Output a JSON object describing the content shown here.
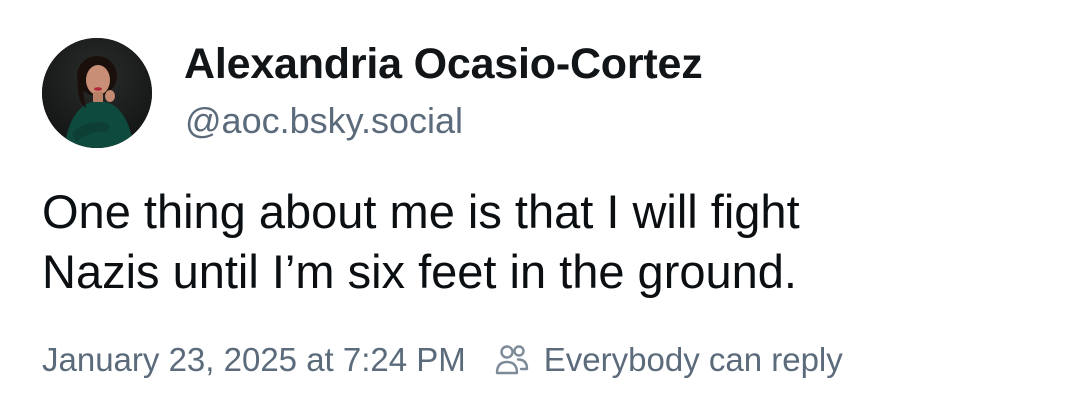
{
  "author": {
    "display_name": "Alexandria Ocasio-Cortez",
    "handle": "@aoc.bsky.social",
    "avatar_icon": "profile-photo"
  },
  "post": {
    "text_lines": [
      "One thing about me is that I will fight",
      "Nazis until I’m six feet in the ground."
    ]
  },
  "meta": {
    "timestamp": "January 23, 2025 at 7:24 PM",
    "reply_setting": "Everybody can reply",
    "reply_icon": "people-icon"
  },
  "colors": {
    "text_primary": "#0b0f12",
    "text_secondary": "#5b6b7b",
    "background": "#ffffff"
  }
}
